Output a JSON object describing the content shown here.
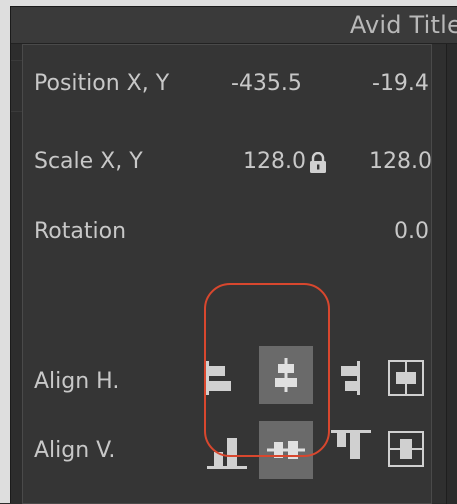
{
  "window": {
    "title": "Avid Title"
  },
  "properties": {
    "position": {
      "label": "Position X, Y",
      "x": "-435.5",
      "y": "-19.4"
    },
    "scale": {
      "label": "Scale X, Y",
      "x": "128.0",
      "y": "128.0",
      "lock_icon": "lock-icon",
      "locked": true
    },
    "rotation": {
      "label": "Rotation",
      "value": "0.0"
    }
  },
  "align_h": {
    "label": "Align H.",
    "options": [
      {
        "icon": "align-left-icon",
        "selected": false
      },
      {
        "icon": "align-center-horizontal-icon",
        "selected": true
      },
      {
        "icon": "align-right-icon",
        "selected": false
      },
      {
        "icon": "center-in-frame-horizontal-icon",
        "selected": false
      }
    ]
  },
  "align_v": {
    "label": "Align V.",
    "options": [
      {
        "icon": "align-bottom-icon",
        "selected": false
      },
      {
        "icon": "align-center-vertical-icon",
        "selected": true
      },
      {
        "icon": "align-top-icon",
        "selected": false
      },
      {
        "icon": "center-in-frame-vertical-icon",
        "selected": false
      }
    ]
  },
  "colors": {
    "panel_bg": "#353535",
    "text": "#c8c8c8",
    "selected_button": "#6a6a6a",
    "icon": "#d0d0d0",
    "highlight": "#d8472e"
  }
}
